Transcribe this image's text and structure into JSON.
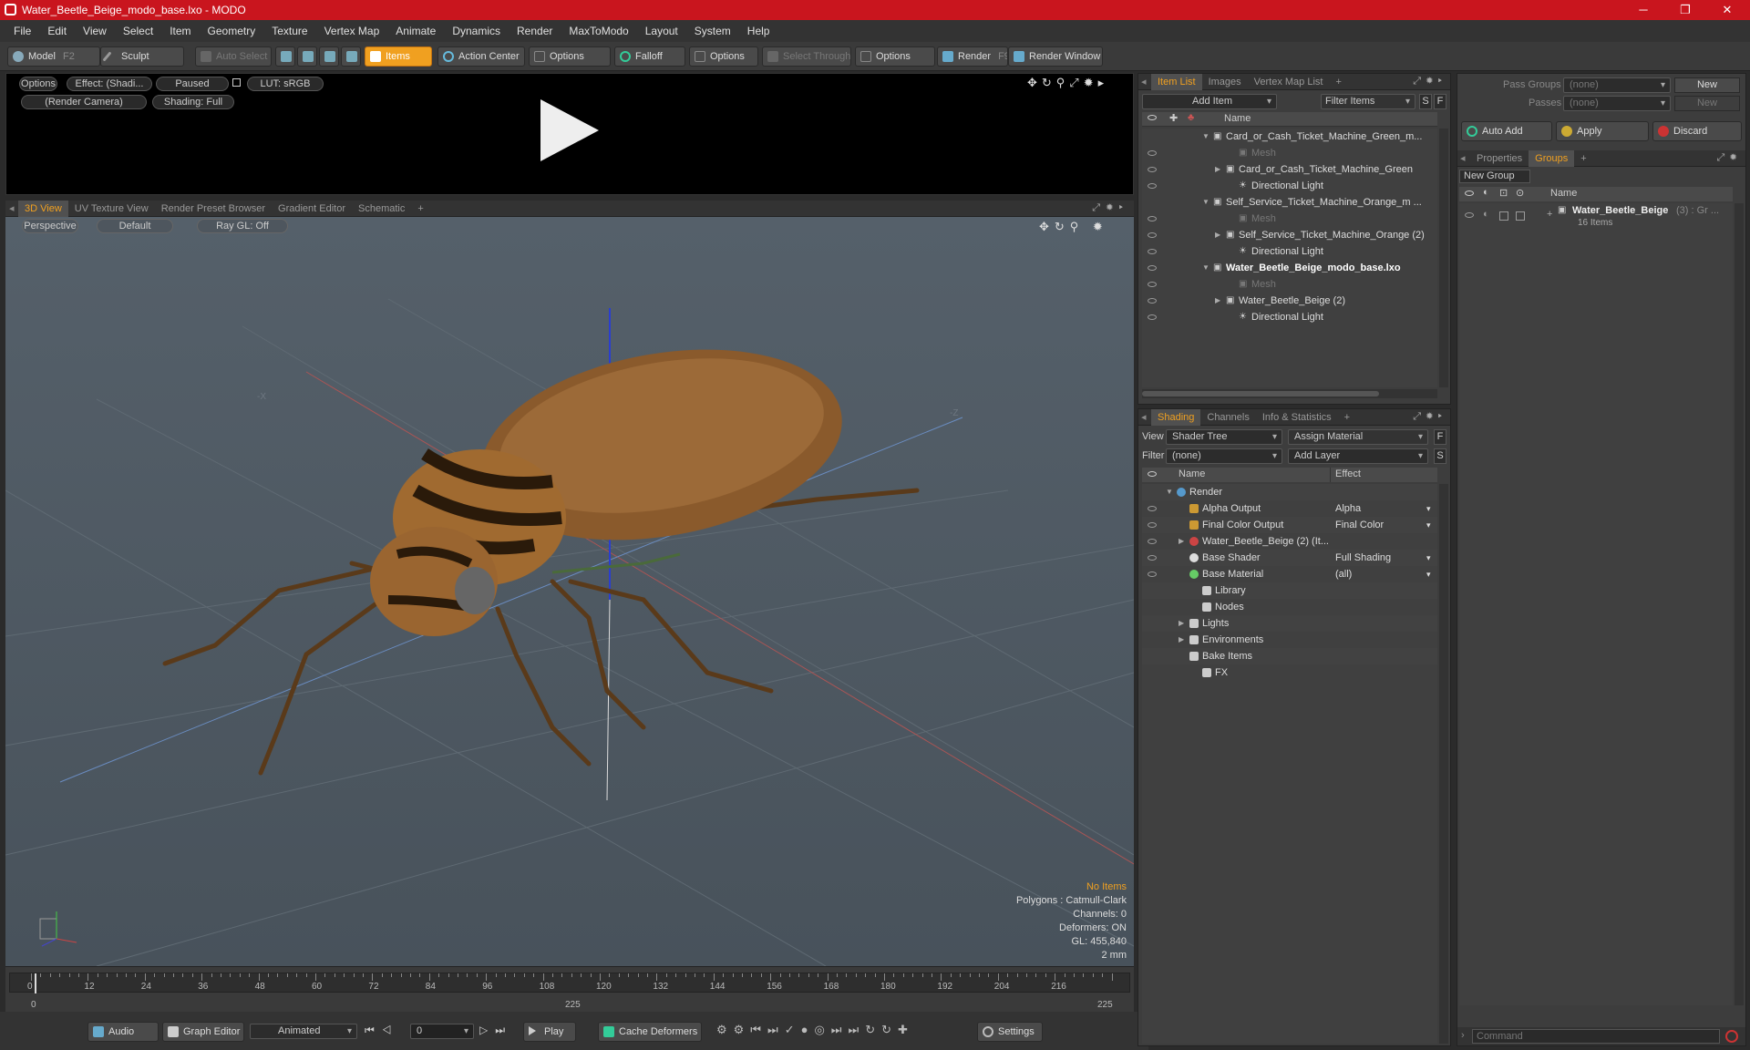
{
  "window": {
    "title": "Water_Beetle_Beige_modo_base.lxo - MODO"
  },
  "menu": [
    "File",
    "Edit",
    "View",
    "Select",
    "Item",
    "Geometry",
    "Texture",
    "Vertex Map",
    "Animate",
    "Dynamics",
    "Render",
    "MaxToModo",
    "Layout",
    "System",
    "Help"
  ],
  "toolbar": {
    "model": "Model",
    "model_key": "F2",
    "sculpt": "Sculpt",
    "auto_select": "Auto Select",
    "items": "Items",
    "action_center": "Action Center",
    "options1": "Options",
    "falloff": "Falloff",
    "options2": "Options",
    "select_through": "Select Through",
    "options3": "Options",
    "render": "Render",
    "render_key": "F9",
    "render_window": "Render Window"
  },
  "preview": {
    "options": "Options",
    "effect": "Effect: (Shadi...",
    "paused": "Paused",
    "lut": "LUT: sRGB",
    "camera": "(Render Camera)",
    "shading": "Shading: Full"
  },
  "viewport_tabs": [
    "3D View",
    "UV Texture View",
    "Render Preset Browser",
    "Gradient Editor",
    "Schematic",
    "+"
  ],
  "viewport": {
    "perspective": "Perspective",
    "default": "Default",
    "raygl": "Ray GL: Off",
    "axis_x": "-X",
    "axis_z": "-Z",
    "stats": {
      "no_items": "No Items",
      "polygons": "Polygons : Catmull-Clark",
      "channels": "Channels: 0",
      "deformers": "Deformers: ON",
      "gl": "GL: 455,840",
      "scale": "2 mm"
    }
  },
  "timeline": {
    "ticks": [
      "0",
      "12",
      "24",
      "36",
      "48",
      "60",
      "72",
      "84",
      "96",
      "108",
      "120",
      "132",
      "144",
      "156",
      "168",
      "180",
      "192",
      "204",
      "216"
    ],
    "start": "0",
    "mid": "225",
    "end": "225"
  },
  "bottombar": {
    "audio": "Audio",
    "graph_editor": "Graph Editor",
    "animated": "Animated",
    "frame": "0",
    "play": "Play",
    "cache": "Cache Deformers",
    "settings": "Settings"
  },
  "itemlist": {
    "tabs": [
      "Item List",
      "Images",
      "Vertex Map List",
      "+"
    ],
    "add_item": "Add Item",
    "filter_items": "Filter Items",
    "s": "S",
    "f": "F",
    "col_name": "Name",
    "rows": [
      {
        "label": "Card_or_Cash_Ticket_Machine_Green_m...",
        "indent": 0,
        "bold": false,
        "eye": false,
        "dim": false
      },
      {
        "label": "Mesh",
        "indent": 2,
        "bold": false,
        "eye": true,
        "dim": true
      },
      {
        "label": "Card_or_Cash_Ticket_Machine_Green",
        "indent": 1,
        "bold": false,
        "eye": true,
        "dim": false
      },
      {
        "label": "Directional Light",
        "indent": 2,
        "bold": false,
        "eye": true,
        "dim": false
      },
      {
        "label": "Self_Service_Ticket_Machine_Orange_m ...",
        "indent": 0,
        "bold": false,
        "eye": false,
        "dim": false
      },
      {
        "label": "Mesh",
        "indent": 2,
        "bold": false,
        "eye": true,
        "dim": true
      },
      {
        "label": "Self_Service_Ticket_Machine_Orange (2)",
        "indent": 1,
        "bold": false,
        "eye": true,
        "dim": false
      },
      {
        "label": "Directional Light",
        "indent": 2,
        "bold": false,
        "eye": true,
        "dim": false
      },
      {
        "label": "Water_Beetle_Beige_modo_base.lxo",
        "indent": 0,
        "bold": true,
        "eye": true,
        "dim": false
      },
      {
        "label": "Mesh",
        "indent": 2,
        "bold": false,
        "eye": true,
        "dim": true
      },
      {
        "label": "Water_Beetle_Beige (2)",
        "indent": 1,
        "bold": false,
        "eye": true,
        "dim": false
      },
      {
        "label": "Directional Light",
        "indent": 2,
        "bold": false,
        "eye": true,
        "dim": false
      }
    ]
  },
  "shading": {
    "tabs": [
      "Shading",
      "Channels",
      "Info & Statistics",
      "+"
    ],
    "view_label": "View",
    "view_value": "Shader Tree",
    "assign": "Assign Material",
    "filter_label": "Filter",
    "filter_value": "(none)",
    "add_layer": "Add Layer",
    "col_name": "Name",
    "col_effect": "Effect",
    "rows": [
      {
        "label": "Render",
        "effect": "",
        "indent": 0,
        "eye": false
      },
      {
        "label": "Alpha Output",
        "effect": "Alpha",
        "indent": 1,
        "eye": true
      },
      {
        "label": "Final Color Output",
        "effect": "Final Color",
        "indent": 1,
        "eye": true
      },
      {
        "label": "Water_Beetle_Beige (2) (It...",
        "effect": "",
        "indent": 1,
        "eye": true
      },
      {
        "label": "Base Shader",
        "effect": "Full Shading",
        "indent": 1,
        "eye": true
      },
      {
        "label": "Base Material",
        "effect": "(all)",
        "indent": 1,
        "eye": true
      },
      {
        "label": "Library",
        "effect": "",
        "indent": 2,
        "eye": false
      },
      {
        "label": "Nodes",
        "effect": "",
        "indent": 2,
        "eye": false
      },
      {
        "label": "Lights",
        "effect": "",
        "indent": 1,
        "eye": false
      },
      {
        "label": "Environments",
        "effect": "",
        "indent": 1,
        "eye": false
      },
      {
        "label": "Bake Items",
        "effect": "",
        "indent": 1,
        "eye": false
      },
      {
        "label": "FX",
        "effect": "",
        "indent": 2,
        "eye": false
      }
    ]
  },
  "groups": {
    "pass_groups": "Pass Groups",
    "passes": "Passes",
    "none1": "(none)",
    "none2": "(none)",
    "new1": "New",
    "new2": "New",
    "auto_add": "Auto Add",
    "apply": "Apply",
    "discard": "Discard",
    "tabs": [
      "Properties",
      "Groups",
      "+"
    ],
    "new_group": "New Group",
    "col_name": "Name",
    "group_name": "Water_Beetle_Beige",
    "group_count": "(3) : Gr ...",
    "group_items": "16 Items"
  },
  "command": {
    "placeholder": "Command"
  }
}
